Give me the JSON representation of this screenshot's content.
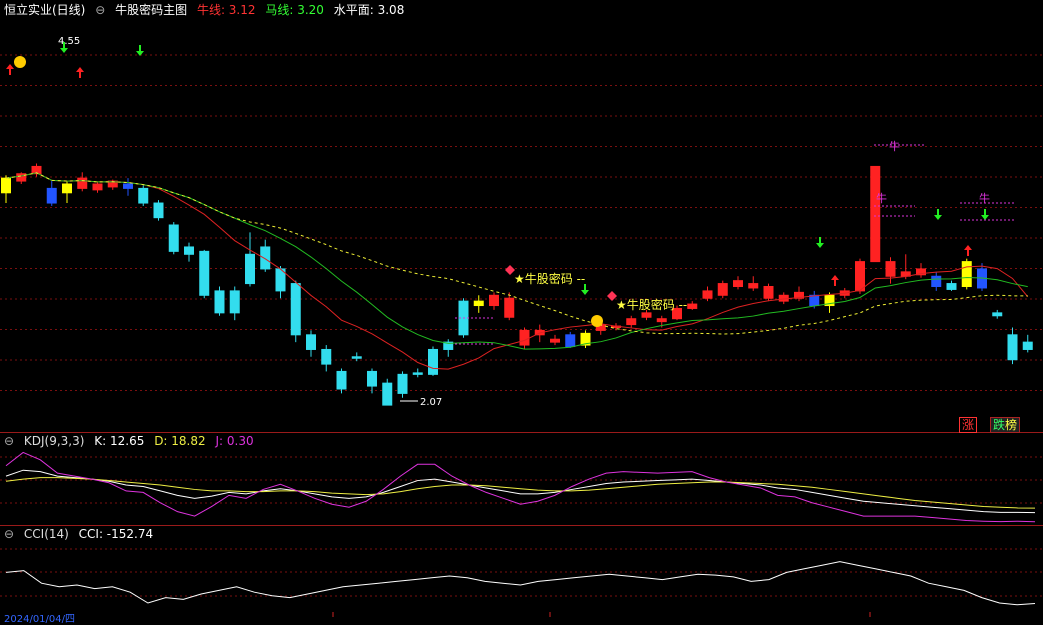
{
  "main": {
    "title": "恒立实业(日线)",
    "indicator_name": "牛股密码主图",
    "niu_label": "牛线: 3.12",
    "ma_label": "马线: 3.20",
    "level_label": "水平面: 3.08",
    "high_label": "4.55",
    "low_label": "2.07",
    "signal_label": "牛股密码 --",
    "niu_char": "牛",
    "niu_color": "#ff3333",
    "ma_color": "#33cc33",
    "level_color": "#ffffff"
  },
  "kdj": {
    "name": "KDJ(9,3,3)",
    "k_label": "K: 12.65",
    "d_label": "D: 18.82",
    "j_label": "J: 0.30"
  },
  "cci": {
    "name": "CCI(14)",
    "cci_label": "CCI: -152.74"
  },
  "badges": {
    "zhang": "涨",
    "die": "跌",
    "bang": "榜"
  },
  "footer": {
    "date": "2024/01/04/四"
  },
  "colors": {
    "up": "#ff2222",
    "down": "#33ddee",
    "yellow_bar": "#ffff00",
    "blue_bar": "#2255ff",
    "grid": "#7a1010",
    "ma_red": "#dd2222",
    "ma_green": "#22bb22",
    "ma_dashed": "#eeee33",
    "kdj_k": "#ffffff",
    "kdj_d": "#eeee44",
    "kdj_j": "#dd33dd",
    "cci": "#ffffff"
  },
  "chart_data": [
    {
      "type": "candlestick",
      "title": "恒立实业(日线)",
      "candles": [
        {
          "o": 3.52,
          "c": 3.62,
          "h": 3.64,
          "l": 3.45,
          "color": "yellow"
        },
        {
          "o": 3.6,
          "c": 3.65,
          "h": 3.66,
          "l": 3.58,
          "color": "up"
        },
        {
          "o": 3.65,
          "c": 3.7,
          "h": 3.72,
          "l": 3.63,
          "color": "up"
        },
        {
          "o": 3.55,
          "c": 3.45,
          "h": 3.6,
          "l": 3.43,
          "color": "blue"
        },
        {
          "o": 3.52,
          "c": 3.58,
          "h": 3.6,
          "l": 3.45,
          "color": "yellow"
        },
        {
          "o": 3.55,
          "c": 3.62,
          "h": 3.66,
          "l": 3.53,
          "color": "up"
        },
        {
          "o": 3.58,
          "c": 3.54,
          "h": 3.6,
          "l": 3.52,
          "color": "up"
        },
        {
          "o": 3.56,
          "c": 3.6,
          "h": 3.61,
          "l": 3.54,
          "color": "up"
        },
        {
          "o": 3.58,
          "c": 3.55,
          "h": 3.62,
          "l": 3.5,
          "color": "blue"
        },
        {
          "o": 3.55,
          "c": 3.45,
          "h": 3.57,
          "l": 3.43,
          "color": "down"
        },
        {
          "o": 3.45,
          "c": 3.35,
          "h": 3.47,
          "l": 3.33,
          "color": "down"
        },
        {
          "o": 3.3,
          "c": 3.12,
          "h": 3.32,
          "l": 3.1,
          "color": "down"
        },
        {
          "o": 3.15,
          "c": 3.1,
          "h": 3.18,
          "l": 3.05,
          "color": "down"
        },
        {
          "o": 3.12,
          "c": 2.82,
          "h": 3.13,
          "l": 2.8,
          "color": "down"
        },
        {
          "o": 2.85,
          "c": 2.7,
          "h": 2.88,
          "l": 2.68,
          "color": "down"
        },
        {
          "o": 2.85,
          "c": 2.7,
          "h": 2.88,
          "l": 2.65,
          "color": "down"
        },
        {
          "o": 3.1,
          "c": 2.9,
          "h": 3.25,
          "l": 2.88,
          "color": "down"
        },
        {
          "o": 3.15,
          "c": 3.0,
          "h": 3.2,
          "l": 2.98,
          "color": "down"
        },
        {
          "o": 3.0,
          "c": 2.85,
          "h": 3.02,
          "l": 2.8,
          "color": "down"
        },
        {
          "o": 2.9,
          "c": 2.55,
          "h": 2.92,
          "l": 2.5,
          "color": "down"
        },
        {
          "o": 2.55,
          "c": 2.45,
          "h": 2.58,
          "l": 2.4,
          "color": "down"
        },
        {
          "o": 2.45,
          "c": 2.35,
          "h": 2.48,
          "l": 2.3,
          "color": "down"
        },
        {
          "o": 2.3,
          "c": 2.18,
          "h": 2.32,
          "l": 2.15,
          "color": "down"
        },
        {
          "o": 2.4,
          "c": 2.39,
          "h": 2.43,
          "l": 2.37,
          "color": "down"
        },
        {
          "o": 2.3,
          "c": 2.2,
          "h": 2.32,
          "l": 2.15,
          "color": "down"
        },
        {
          "o": 2.22,
          "c": 2.07,
          "h": 2.25,
          "l": 2.07,
          "color": "down"
        },
        {
          "o": 2.15,
          "c": 2.28,
          "h": 2.3,
          "l": 2.12,
          "color": "down"
        },
        {
          "o": 2.28,
          "c": 2.29,
          "h": 2.32,
          "l": 2.26,
          "color": "down"
        },
        {
          "o": 2.28,
          "c": 2.45,
          "h": 2.47,
          "l": 2.27,
          "color": "down"
        },
        {
          "o": 2.45,
          "c": 2.5,
          "h": 2.52,
          "l": 2.4,
          "color": "down"
        },
        {
          "o": 2.55,
          "c": 2.78,
          "h": 2.8,
          "l": 2.53,
          "color": "down"
        },
        {
          "o": 2.75,
          "c": 2.78,
          "h": 2.82,
          "l": 2.7,
          "color": "yellow"
        },
        {
          "o": 2.75,
          "c": 2.82,
          "h": 2.84,
          "l": 2.72,
          "color": "up"
        },
        {
          "o": 2.8,
          "c": 2.67,
          "h": 2.84,
          "l": 2.65,
          "color": "up"
        },
        {
          "o": 2.58,
          "c": 2.48,
          "h": 2.6,
          "l": 2.45,
          "color": "up"
        },
        {
          "o": 2.55,
          "c": 2.58,
          "h": 2.62,
          "l": 2.5,
          "color": "up"
        },
        {
          "o": 2.52,
          "c": 2.5,
          "h": 2.55,
          "l": 2.48,
          "color": "up"
        },
        {
          "o": 2.55,
          "c": 2.47,
          "h": 2.57,
          "l": 2.46,
          "color": "blue"
        },
        {
          "o": 2.48,
          "c": 2.56,
          "h": 2.58,
          "l": 2.46,
          "color": "yellow"
        },
        {
          "o": 2.58,
          "c": 2.62,
          "h": 2.63,
          "l": 2.55,
          "color": "up"
        },
        {
          "o": 2.6,
          "c": 2.61,
          "h": 2.63,
          "l": 2.58,
          "color": "up"
        },
        {
          "o": 2.62,
          "c": 2.66,
          "h": 2.68,
          "l": 2.6,
          "color": "up"
        },
        {
          "o": 2.67,
          "c": 2.7,
          "h": 2.72,
          "l": 2.65,
          "color": "up"
        },
        {
          "o": 2.66,
          "c": 2.64,
          "h": 2.68,
          "l": 2.6,
          "color": "up"
        },
        {
          "o": 2.66,
          "c": 2.73,
          "h": 2.75,
          "l": 2.65,
          "color": "up"
        },
        {
          "o": 2.73,
          "c": 2.76,
          "h": 2.78,
          "l": 2.72,
          "color": "up"
        },
        {
          "o": 2.8,
          "c": 2.85,
          "h": 2.88,
          "l": 2.78,
          "color": "up"
        },
        {
          "o": 2.82,
          "c": 2.9,
          "h": 2.92,
          "l": 2.8,
          "color": "up"
        },
        {
          "o": 2.88,
          "c": 2.92,
          "h": 2.95,
          "l": 2.86,
          "color": "up"
        },
        {
          "o": 2.9,
          "c": 2.87,
          "h": 2.95,
          "l": 2.85,
          "color": "up"
        },
        {
          "o": 2.88,
          "c": 2.8,
          "h": 2.9,
          "l": 2.78,
          "color": "up"
        },
        {
          "o": 2.82,
          "c": 2.78,
          "h": 2.84,
          "l": 2.76,
          "color": "up"
        },
        {
          "o": 2.84,
          "c": 2.8,
          "h": 2.88,
          "l": 2.78,
          "color": "up"
        },
        {
          "o": 2.82,
          "c": 2.75,
          "h": 2.85,
          "l": 2.73,
          "color": "blue"
        },
        {
          "o": 2.75,
          "c": 2.82,
          "h": 2.84,
          "l": 2.7,
          "color": "yellow"
        },
        {
          "o": 2.82,
          "c": 2.85,
          "h": 2.87,
          "l": 2.8,
          "color": "up"
        },
        {
          "o": 2.85,
          "c": 3.05,
          "h": 3.07,
          "l": 2.83,
          "color": "up"
        },
        {
          "o": 3.05,
          "c": 3.7,
          "h": 3.7,
          "l": 3.2,
          "color": "up"
        },
        {
          "o": 3.05,
          "c": 2.95,
          "h": 3.08,
          "l": 2.9,
          "color": "up"
        },
        {
          "o": 2.95,
          "c": 2.98,
          "h": 3.1,
          "l": 2.93,
          "color": "up"
        },
        {
          "o": 2.96,
          "c": 3.0,
          "h": 3.04,
          "l": 2.94,
          "color": "up"
        },
        {
          "o": 2.95,
          "c": 2.88,
          "h": 2.98,
          "l": 2.85,
          "color": "blue"
        },
        {
          "o": 2.9,
          "c": 2.86,
          "h": 2.92,
          "l": 2.85,
          "color": "down"
        },
        {
          "o": 2.88,
          "c": 3.05,
          "h": 3.07,
          "l": 2.86,
          "color": "yellow"
        },
        {
          "o": 3.0,
          "c": 2.87,
          "h": 3.04,
          "l": 2.85,
          "color": "blue"
        },
        {
          "o": 2.7,
          "c": 2.68,
          "h": 2.72,
          "l": 2.66,
          "color": "down"
        },
        {
          "o": 2.55,
          "c": 2.38,
          "h": 2.6,
          "l": 2.35,
          "color": "down"
        },
        {
          "o": 2.5,
          "c": 2.45,
          "h": 2.55,
          "l": 2.43,
          "color": "down"
        }
      ],
      "ylim": [
        1.9,
        4.7
      ],
      "lines": [
        "牛线",
        "马线",
        "水平面"
      ],
      "annotations": [
        "4.55",
        "2.07",
        "牛股密码 --",
        "牛"
      ]
    },
    {
      "type": "line",
      "title": "KDJ(9,3,3)",
      "series": [
        {
          "name": "K",
          "values": [
            62,
            70,
            68,
            62,
            60,
            58,
            55,
            50,
            48,
            42,
            36,
            32,
            35,
            40,
            38,
            42,
            45,
            42,
            38,
            34,
            32,
            34,
            40,
            48,
            56,
            58,
            54,
            50,
            46,
            42,
            38,
            38,
            40,
            44,
            48,
            52,
            54,
            55,
            56,
            57,
            58,
            56,
            54,
            52,
            50,
            46,
            44,
            40,
            36,
            32,
            28,
            26,
            24,
            22,
            20,
            18,
            16,
            14,
            13,
            13,
            12.65
          ]
        },
        {
          "name": "D",
          "values": [
            55,
            58,
            60,
            60,
            59,
            58,
            56,
            54,
            52,
            50,
            47,
            44,
            42,
            42,
            41,
            41,
            42,
            42,
            41,
            39,
            38,
            37,
            38,
            41,
            45,
            48,
            50,
            50,
            49,
            47,
            45,
            43,
            42,
            42,
            43,
            45,
            47,
            49,
            51,
            52,
            53,
            54,
            54,
            53,
            52,
            51,
            49,
            47,
            44,
            41,
            38,
            35,
            32,
            29,
            27,
            25,
            23,
            21,
            20,
            19,
            18.82
          ]
        },
        {
          "name": "J",
          "values": [
            76,
            94,
            84,
            66,
            62,
            58,
            53,
            42,
            40,
            26,
            14,
            8,
            21,
            36,
            32,
            44,
            51,
            42,
            32,
            24,
            20,
            28,
            44,
            62,
            78,
            78,
            62,
            50,
            40,
            32,
            24,
            28,
            36,
            48,
            58,
            66,
            68,
            67,
            66,
            67,
            68,
            60,
            54,
            50,
            46,
            36,
            34,
            26,
            20,
            14,
            8,
            8,
            8,
            8,
            6,
            4,
            2,
            1,
            0.5,
            1,
            0.3
          ]
        }
      ]
    },
    {
      "type": "line",
      "title": "CCI(14)",
      "series": [
        {
          "name": "CCI",
          "values": [
            20,
            30,
            -40,
            -60,
            -50,
            -70,
            -60,
            -90,
            -150,
            -120,
            -130,
            -100,
            -80,
            -60,
            -90,
            -110,
            -120,
            -100,
            -80,
            -60,
            -50,
            -40,
            -30,
            -20,
            -10,
            0,
            -10,
            -30,
            -40,
            -50,
            -30,
            -20,
            -10,
            0,
            10,
            0,
            -10,
            -20,
            -5,
            10,
            5,
            -5,
            -30,
            -20,
            20,
            40,
            60,
            80,
            60,
            40,
            20,
            0,
            -40,
            -60,
            -80,
            -120,
            -150,
            -160,
            -152.74
          ]
        }
      ]
    }
  ]
}
